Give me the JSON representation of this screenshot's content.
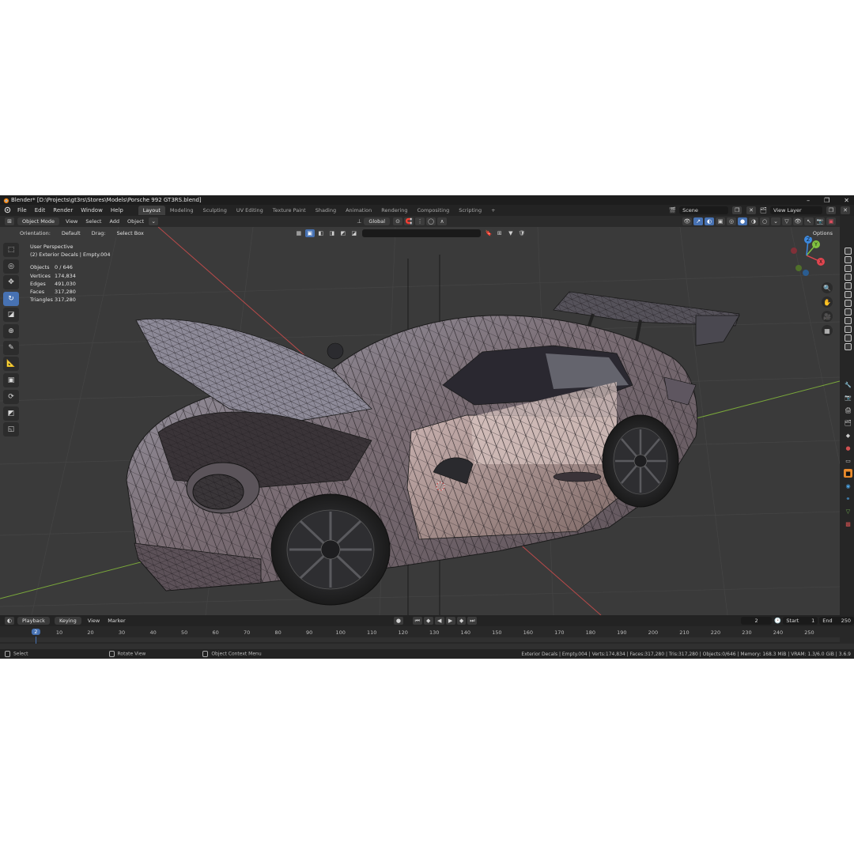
{
  "window": {
    "title": "Blender* [D:\\Projects\\gt3rs\\Stores\\Models\\Porsche 992 GT3RS.blend]",
    "minimize": "–",
    "maximize": "❐",
    "close": "✕"
  },
  "menu": [
    "File",
    "Edit",
    "Render",
    "Window",
    "Help"
  ],
  "workspaces": [
    {
      "label": "Layout",
      "active": true
    },
    {
      "label": "Modeling",
      "active": false
    },
    {
      "label": "Sculpting",
      "active": false
    },
    {
      "label": "UV Editing",
      "active": false
    },
    {
      "label": "Texture Paint",
      "active": false
    },
    {
      "label": "Shading",
      "active": false
    },
    {
      "label": "Animation",
      "active": false
    },
    {
      "label": "Rendering",
      "active": false
    },
    {
      "label": "Compositing",
      "active": false
    },
    {
      "label": "Scripting",
      "active": false
    }
  ],
  "add_workspace": "+",
  "scene": {
    "name": "Scene",
    "view_layer": "View Layer"
  },
  "header": {
    "mode": "Object Mode",
    "view": "View",
    "select": "Select",
    "add": "Add",
    "object": "Object",
    "transform_orientation": "Global",
    "orientation_label": "Orientation:",
    "orientation_value": "Default",
    "drag_label": "Drag:",
    "drag_value": "Select Box",
    "options": "Options"
  },
  "viewport": {
    "perspective": "User Perspective",
    "active_object": "(2) Exterior Decals | Empty.004",
    "stats": [
      {
        "label": "Objects",
        "value": "0 / 646"
      },
      {
        "label": "Vertices",
        "value": "174,834"
      },
      {
        "label": "Edges",
        "value": "491,030"
      },
      {
        "label": "Faces",
        "value": "317,280"
      },
      {
        "label": "Triangles",
        "value": "317,280"
      }
    ]
  },
  "tools": [
    {
      "name": "select-box-tool",
      "glyph": "⬚",
      "active": false
    },
    {
      "name": "cursor-tool",
      "glyph": "◎",
      "active": false
    },
    {
      "name": "move-tool",
      "glyph": "✥",
      "active": false
    },
    {
      "name": "rotate-tool",
      "glyph": "↻",
      "active": true
    },
    {
      "name": "scale-tool",
      "glyph": "◪",
      "active": false
    },
    {
      "name": "transform-tool",
      "glyph": "⊕",
      "active": false
    },
    {
      "name": "annotate-tool",
      "glyph": "✎",
      "active": false
    },
    {
      "name": "measure-tool",
      "glyph": "📐",
      "active": false
    },
    {
      "name": "add-cube-tool",
      "glyph": "▣",
      "active": false
    },
    {
      "name": "spin-tool",
      "glyph": "⟳",
      "active": false
    },
    {
      "name": "shear-tool",
      "glyph": "◩",
      "active": false
    },
    {
      "name": "extra-tool",
      "glyph": "◱",
      "active": false
    }
  ],
  "gizmo": {
    "x": "X",
    "y": "Y",
    "z": "Z"
  },
  "timeline": {
    "playback": "Playback",
    "keying": "Keying",
    "view": "View",
    "marker": "Marker",
    "current_frame": "2",
    "start_label": "Start",
    "start": "1",
    "end_label": "End",
    "end": "250",
    "ticks": [
      "2",
      "10",
      "20",
      "30",
      "40",
      "50",
      "60",
      "70",
      "80",
      "90",
      "100",
      "110",
      "120",
      "130",
      "140",
      "150",
      "160",
      "170",
      "180",
      "190",
      "200",
      "210",
      "220",
      "230",
      "240",
      "250"
    ]
  },
  "statusbar": {
    "select": "Select",
    "rotate": "Rotate View",
    "context": "Object Context Menu",
    "info": "Exterior Decals | Empty.004 | Verts:174,834 | Faces:317,280 | Tris:317,280 | Objects:0/646 | Memory: 168.3 MiB | VRAM: 1.3/6.0 GiB | 3.6.9"
  },
  "colors": {
    "accent": "#4772b3",
    "axis_x": "#b84a4a",
    "axis_y": "#7aa83a",
    "gizmo_x": "#e0454f",
    "gizmo_y": "#80c040",
    "gizmo_z": "#3d8ae0"
  }
}
